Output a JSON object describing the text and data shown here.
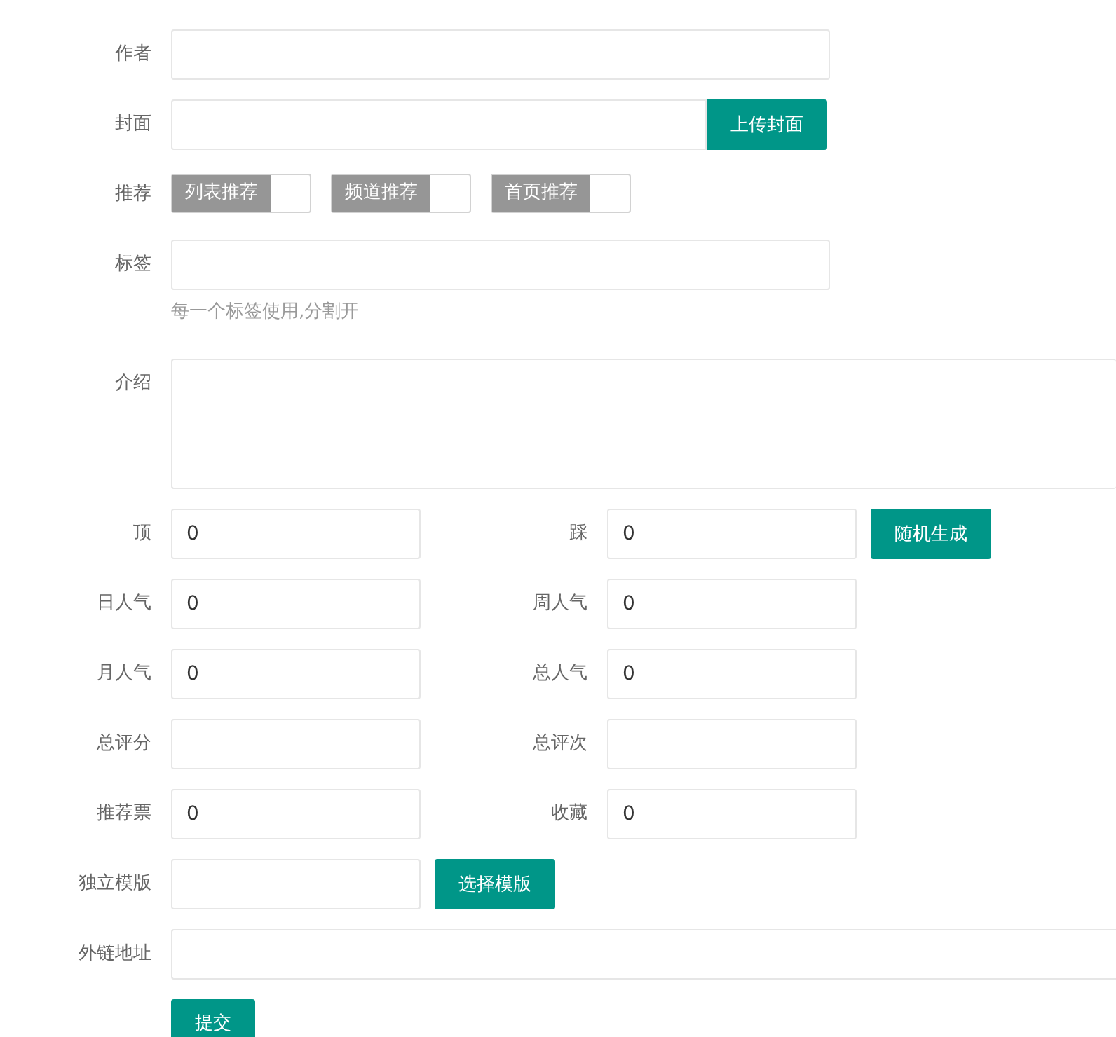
{
  "form": {
    "rows": [
      {
        "kind": "input",
        "label": "作者"
      },
      {
        "kind": "input_button",
        "label": "封面",
        "button": "上传封面"
      },
      {
        "kind": "checkboxes",
        "label": "推荐",
        "options": [
          {
            "label": "列表推荐",
            "checked": false
          },
          {
            "label": "频道推荐",
            "checked": false
          },
          {
            "label": "首页推荐",
            "checked": false
          }
        ]
      },
      {
        "kind": "input",
        "label": "标签",
        "help": "每一个标签使用,分割开"
      },
      {
        "kind": "textarea",
        "label": "介绍"
      },
      {
        "kind": "pair",
        "fields": [
          {
            "label": "顶",
            "value": "0"
          },
          {
            "label": "踩",
            "value": "0"
          }
        ],
        "button": "随机生成"
      },
      {
        "kind": "pair",
        "fields": [
          {
            "label": "日人气",
            "value": "0"
          },
          {
            "label": "周人气",
            "value": "0"
          }
        ]
      },
      {
        "kind": "pair",
        "fields": [
          {
            "label": "月人气",
            "value": "0"
          },
          {
            "label": "总人气",
            "value": "0"
          }
        ]
      },
      {
        "kind": "pair",
        "fields": [
          {
            "label": "总评分"
          },
          {
            "label": "总评次"
          }
        ]
      },
      {
        "kind": "pair",
        "fields": [
          {
            "label": "推荐票",
            "value": "0"
          },
          {
            "label": "收藏",
            "value": "0"
          }
        ]
      },
      {
        "kind": "short_button",
        "label": "独立模版",
        "button": "选择模版"
      },
      {
        "kind": "wide_input",
        "label": "外链地址"
      },
      {
        "kind": "submit",
        "button": "提交"
      }
    ]
  }
}
